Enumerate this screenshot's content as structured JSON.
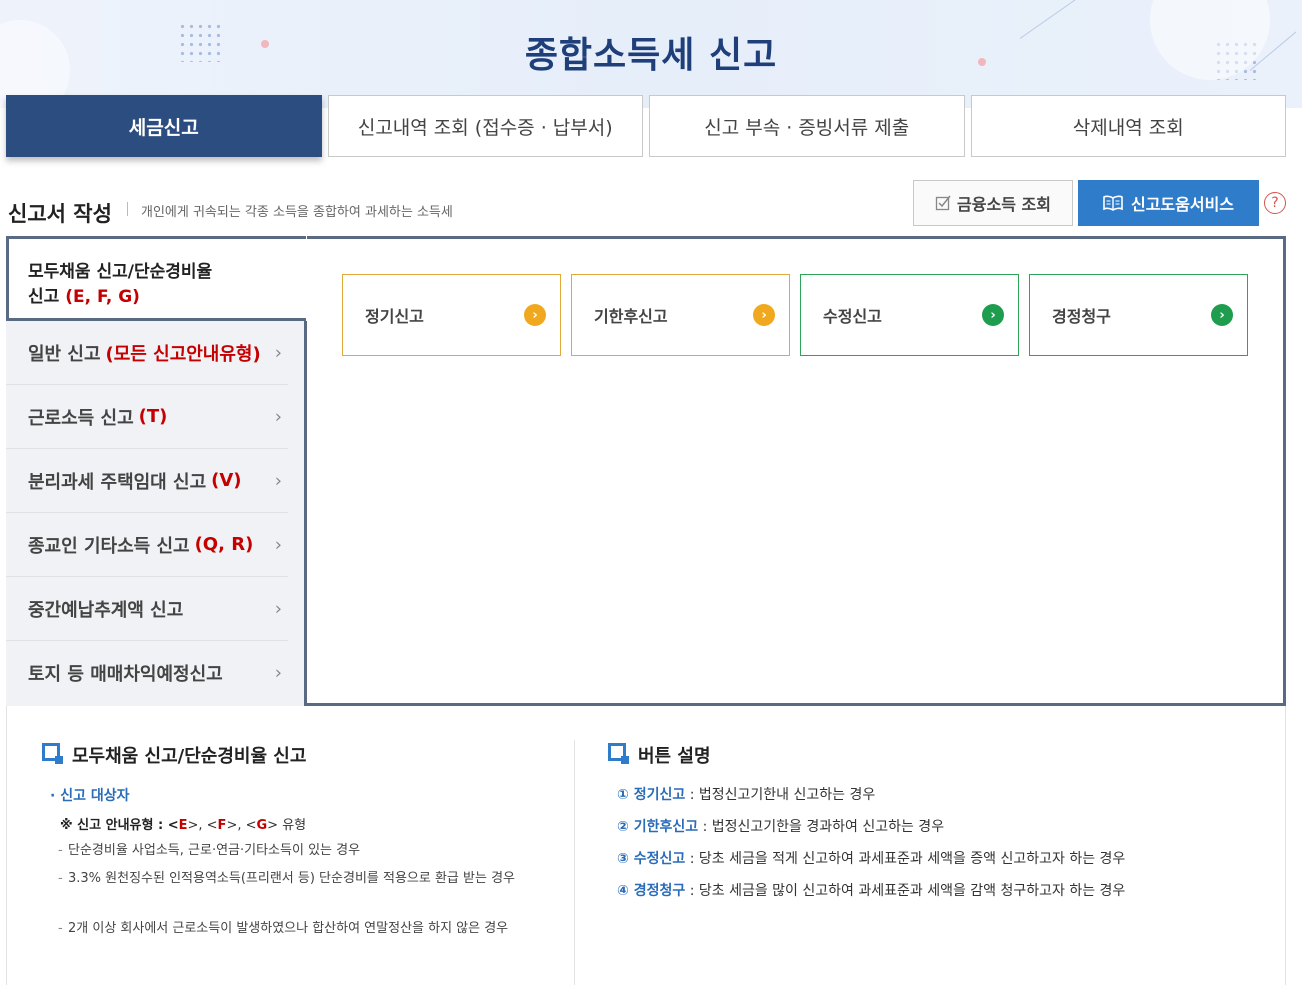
{
  "page": {
    "title": "종합소득세 신고"
  },
  "tabs": [
    {
      "label": "세금신고"
    },
    {
      "label": "신고내역 조회 (접수증 · 납부서)"
    },
    {
      "label": "신고 부속 · 증빙서류 제출"
    },
    {
      "label": "삭제내역 조회"
    }
  ],
  "section": {
    "title": "신고서 작성",
    "description": "개인에게 귀속되는 각종 소득을 종합하여 과세하는 소득세",
    "fin_button": "금융소득 조회",
    "help_button": "신고도움서비스",
    "help_icon": "?"
  },
  "menu": {
    "active": {
      "label_line1": "모두채움 신고/단순경비율",
      "label_line2": "신고",
      "code": "(E, F, G)"
    },
    "items": [
      {
        "label": "일반 신고",
        "code": "(모든 신고안내유형)"
      },
      {
        "label": "근로소득 신고",
        "code": "(T)"
      },
      {
        "label": "분리과세 주택임대 신고",
        "code": "(V)"
      },
      {
        "label": "종교인 기타소득 신고",
        "code": "(Q, R)"
      },
      {
        "label": "중간예납추계액 신고",
        "code": ""
      },
      {
        "label": "토지 등 매매차익예정신고",
        "code": ""
      }
    ],
    "chevron": "›"
  },
  "options": [
    {
      "label": "정기신고"
    },
    {
      "label": "기한후신고"
    },
    {
      "label": "수정신고"
    },
    {
      "label": "경정청구"
    }
  ],
  "info_left": {
    "title": "모두채움 신고/단순경비율 신고",
    "subhead": "· 신고 대상자",
    "note_prefix": "※ 신고 안내유형 : <",
    "note_e": "E",
    "note_mid1": ">, <",
    "note_f": "F",
    "note_mid2": ">, <",
    "note_g": "G",
    "note_suffix": "> 유형",
    "bullets": [
      "단순경비율 사업소득, 근로·연금·기타소득이 있는 경우",
      "3.3% 원천징수된 인적용역소득(프리랜서 등) 단순경비를 적용으로 환급 받는 경우",
      "2개 이상 회사에서 근로소득이 발생하였으나 합산하여 연말정산을 하지 않은 경우"
    ]
  },
  "info_right": {
    "title": "버튼 설명",
    "lines": [
      {
        "kw": "① 정기신고",
        "text": " : 법정신고기한내 신고하는 경우"
      },
      {
        "kw": "② 기한후신고",
        "text": " : 법정신고기한을 경과하여 신고하는 경우"
      },
      {
        "kw": "③ 수정신고",
        "text": " : 당초 세금을 적게 신고하여 과세표준과 세액을 증액 신고하고자 하는 경우"
      },
      {
        "kw": "④ 경정청구",
        "text": " : 당초 세금을 많이 신고하여 과세표준과 세액을 감액 청구하고자 하는 경우"
      }
    ]
  }
}
